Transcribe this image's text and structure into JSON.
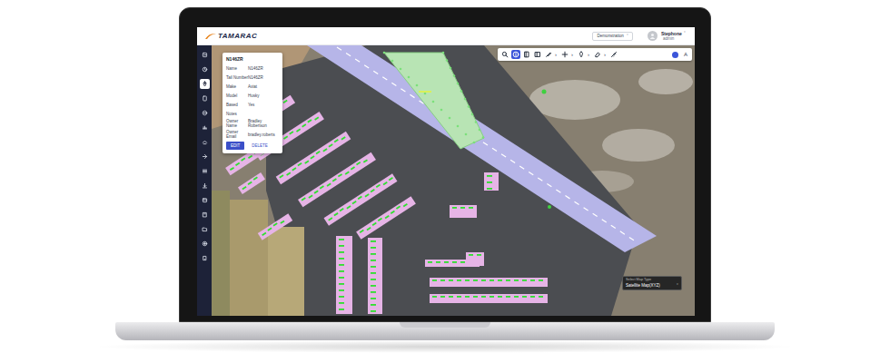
{
  "header": {
    "logo": "TAMARAC",
    "workspace": {
      "label": "Demonstration",
      "caret": "˅"
    },
    "user": {
      "name": "Stephone",
      "caret": "˅",
      "role": "admin"
    }
  },
  "sidebar": {
    "items": [
      {
        "selected": false
      },
      {
        "selected": false
      },
      {
        "selected": true
      },
      {
        "selected": false
      },
      {
        "selected": false
      },
      {
        "selected": false
      },
      {
        "selected": false
      },
      {
        "selected": false
      },
      {
        "selected": false
      },
      {
        "selected": false
      },
      {
        "selected": false
      },
      {
        "selected": false
      },
      {
        "selected": false
      },
      {
        "selected": false
      },
      {
        "selected": false
      }
    ]
  },
  "popup": {
    "title": "N146ZR",
    "fields": [
      {
        "label": "Name",
        "value": "N146ZR"
      },
      {
        "label": "Tail Number",
        "value": "N146ZR"
      },
      {
        "label": "Make",
        "value": "Aviat"
      },
      {
        "label": "Model",
        "value": "Husky"
      },
      {
        "label": "Based",
        "value": "Yes"
      },
      {
        "label": "Notes",
        "value": ""
      },
      {
        "label": "Owner Name",
        "value": "Bradley Robertson"
      },
      {
        "label": "Owner Email",
        "value": "bradley.roberts"
      }
    ],
    "buttons": [
      {
        "label": "EDIT",
        "primary": true
      },
      {
        "label": "DELETE",
        "primary": false
      }
    ]
  },
  "toolbar": {
    "tools": [
      {
        "kind": "search",
        "selected": false,
        "caret": ""
      },
      {
        "kind": "info",
        "selected": true,
        "caret": ""
      },
      {
        "kind": "layers",
        "selected": false,
        "caret": ""
      },
      {
        "kind": "panel",
        "selected": false,
        "caret": ""
      },
      {
        "kind": "brush",
        "selected": false,
        "caret": "›"
      },
      {
        "kind": "plus",
        "selected": false,
        "caret": "›"
      },
      {
        "kind": "pin",
        "selected": false,
        "caret": "›"
      },
      {
        "kind": "eraser",
        "selected": false,
        "caret": "›"
      },
      {
        "kind": "ruler",
        "selected": false,
        "caret": ""
      }
    ],
    "layer_dot": {
      "on": true
    },
    "label_toggle": {
      "label": "A"
    }
  },
  "map_type": {
    "label": "Select Map Type",
    "value": "Satellite Map(XYZ)",
    "caret": "˅"
  }
}
